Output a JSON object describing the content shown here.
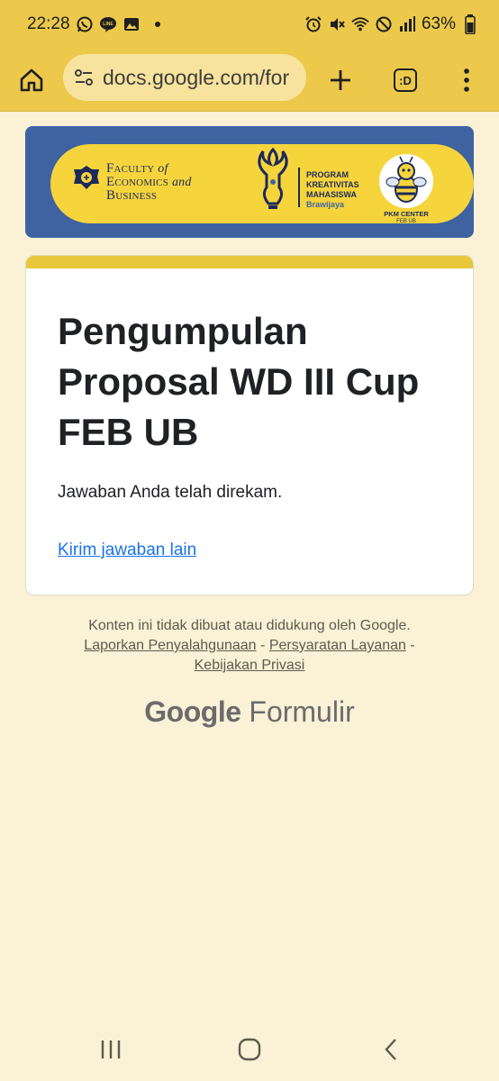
{
  "status": {
    "time": "22:28",
    "battery": "63%",
    "left_icons": [
      "whatsapp-icon",
      "line-icon",
      "gallery-icon"
    ],
    "right_icons": [
      "alarm-icon",
      "mute-icon",
      "wifi-icon",
      "dnd-icon",
      "signal-icon",
      "battery-icon"
    ]
  },
  "browser": {
    "url": "docs.google.com/for",
    "tab_count": ":D"
  },
  "banner": {
    "faculty_line1": "Faculty",
    "faculty_of": "of",
    "faculty_line2": "Economics",
    "faculty_and": "and",
    "faculty_line3": "Business",
    "program_line1": "PROGRAM",
    "program_line2": "KREATIVITAS",
    "program_line3": "MAHASISWA",
    "program_sub": "Brawijaya",
    "pkm_title": "PKM CENTER",
    "pkm_sub": "FEB UB",
    "colors": {
      "background": "#3e63a0",
      "pill": "#f6d43c"
    }
  },
  "form": {
    "title": "Pengumpulan Proposal WD III Cup FEB UB",
    "confirmation": "Jawaban Anda telah direkam.",
    "another_response": "Kirim jawaban lain",
    "accent": "#e8c73a"
  },
  "footer": {
    "disclaimer": "Konten ini tidak dibuat atau didukung oleh Google.",
    "report_abuse": "Laporkan Penyalahgunaan",
    "sep1": "-",
    "terms": "Persyaratan Layanan",
    "sep2": "-",
    "privacy": "Kebijakan Privasi",
    "brand_google": "Google",
    "brand_product": "Formulir"
  },
  "colors": {
    "page_background": "#faf1d6",
    "toolbar": "#ecc94b",
    "link": "#1a73e8"
  }
}
